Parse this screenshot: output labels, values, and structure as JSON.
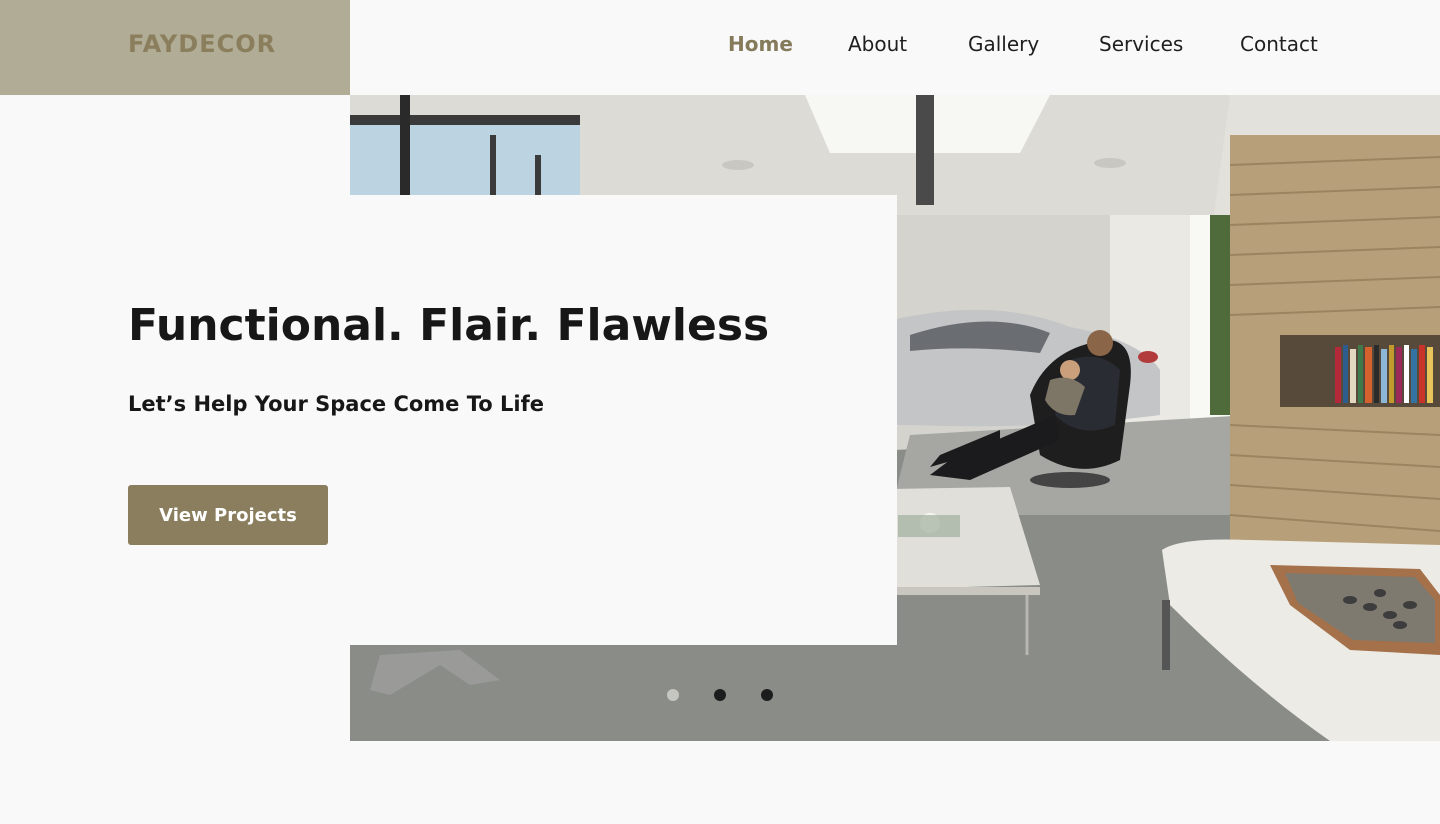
{
  "brand": {
    "logo": "FAYDECOR"
  },
  "nav": {
    "items": [
      {
        "label": "Home",
        "active": true
      },
      {
        "label": "About",
        "active": false
      },
      {
        "label": "Gallery",
        "active": false
      },
      {
        "label": "Services",
        "active": false
      },
      {
        "label": "Contact",
        "active": false
      }
    ]
  },
  "hero": {
    "headline": "Functional. Flair.  Flawless",
    "subheadline": "Let’s Help Your Space Come To Life",
    "cta_label": "View Projects",
    "image_description": "Modern garage lounge with a silver sports car, a man and child in a black lounge chair, wood-slat wall with bookshelf",
    "slides": {
      "count": 3,
      "active_index": 0
    }
  },
  "colors": {
    "accent": "#8a7e5e",
    "logo_bg": "#b0ac95",
    "active_nav": "#857a5a",
    "text": "#171717",
    "background": "#f9f9f9"
  }
}
